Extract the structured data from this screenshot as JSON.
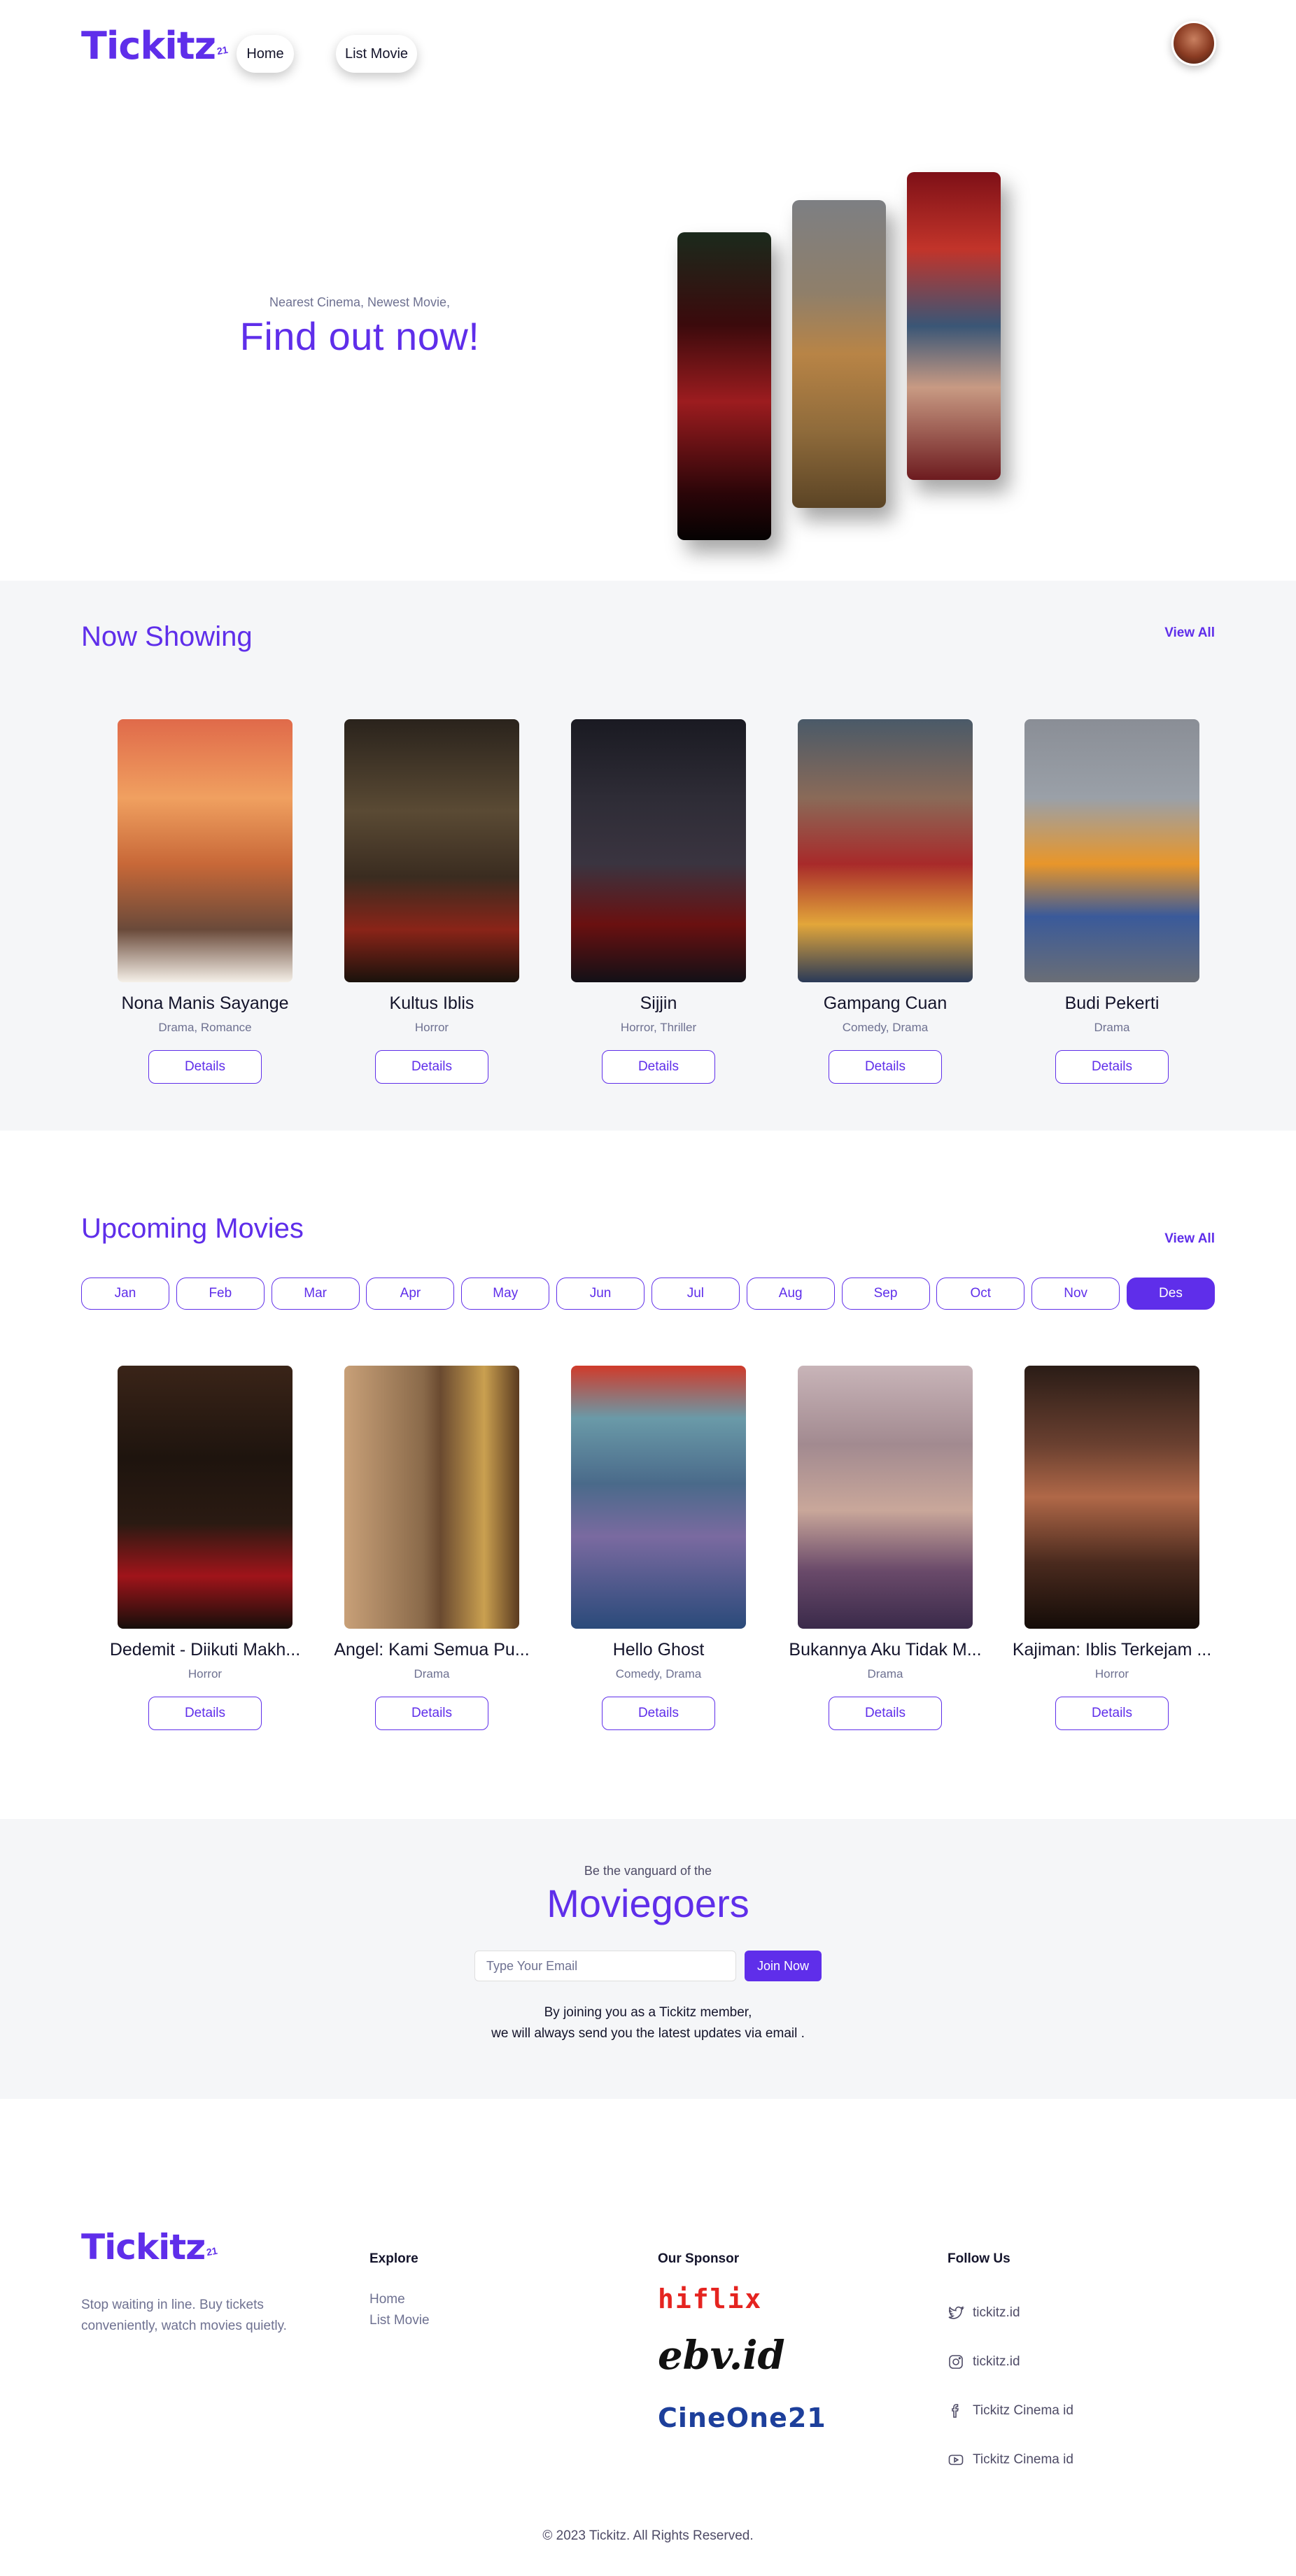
{
  "header": {
    "logo": "Tickitz",
    "logo_badge": "21",
    "nav": [
      {
        "label": "Home"
      },
      {
        "label": "List Movie"
      }
    ]
  },
  "hero": {
    "subtitle": "Nearest Cinema, Newest Movie,",
    "title": "Find out now!"
  },
  "now_showing": {
    "title": "Now Showing",
    "view_all": "View All",
    "movies": [
      {
        "title": "Nona Manis Sayange",
        "genre": "Drama, Romance",
        "button": "Details"
      },
      {
        "title": "Kultus Iblis",
        "genre": "Horror",
        "button": "Details"
      },
      {
        "title": "Sijjin",
        "genre": "Horror, Thriller",
        "button": "Details"
      },
      {
        "title": "Gampang Cuan",
        "genre": "Comedy, Drama",
        "button": "Details"
      },
      {
        "title": "Budi Pekerti",
        "genre": "Drama",
        "button": "Details"
      }
    ]
  },
  "upcoming": {
    "title": "Upcoming Movies",
    "view_all": "View All",
    "months": [
      "Jan",
      "Feb",
      "Mar",
      "Apr",
      "May",
      "Jun",
      "Jul",
      "Aug",
      "Sep",
      "Oct",
      "Nov",
      "Des"
    ],
    "active_month": "Des",
    "movies": [
      {
        "title": "Dedemit - Diikuti Makh...",
        "genre": "Horror",
        "button": "Details"
      },
      {
        "title": "Angel: Kami Semua Pu...",
        "genre": "Drama",
        "button": "Details"
      },
      {
        "title": "Hello Ghost",
        "genre": "Comedy, Drama",
        "button": "Details"
      },
      {
        "title": "Bukannya Aku Tidak M...",
        "genre": "Drama",
        "button": "Details"
      },
      {
        "title": "Kajiman: Iblis Terkejam ...",
        "genre": "Horror",
        "button": "Details"
      }
    ]
  },
  "newsletter": {
    "subtitle": "Be the vanguard of the",
    "title": "Moviegoers",
    "email_placeholder": "Type Your Email",
    "button": "Join Now",
    "note_line1": "By joining you as a Tickitz member,",
    "note_line2": "we will always send you the latest updates via email ."
  },
  "footer": {
    "logo": "Tickitz",
    "logo_badge": "21",
    "description": "Stop waiting in line. Buy tickets conveniently, watch movies quietly.",
    "explore": {
      "title": "Explore",
      "links": [
        "Home",
        "List Movie"
      ]
    },
    "sponsor": {
      "title": "Our Sponsor",
      "items": [
        "hiflix",
        "ebv.id",
        "CineOne21"
      ]
    },
    "follow": {
      "title": "Follow Us",
      "items": [
        {
          "icon": "twitter-icon",
          "label": "tickitz.id"
        },
        {
          "icon": "instagram-icon",
          "label": "tickitz.id"
        },
        {
          "icon": "facebook-icon",
          "label": "Tickitz Cinema id"
        },
        {
          "icon": "youtube-icon",
          "label": "Tickitz Cinema id"
        }
      ]
    },
    "copyright": "© 2023 Tickitz. All Rights Reserved."
  },
  "colors": {
    "primary": "#5f2eea",
    "band": "#f5f6f8",
    "text": "#14142b",
    "muted": "#6e7191"
  }
}
